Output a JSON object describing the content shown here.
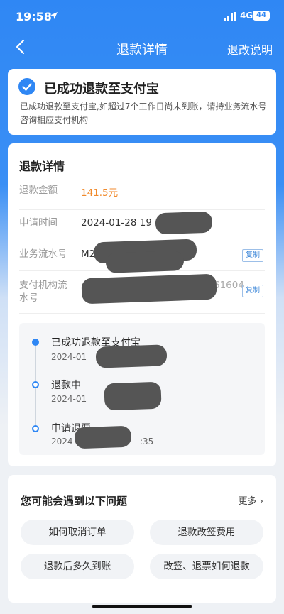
{
  "status_bar": {
    "time": "19:58",
    "network": "4G",
    "battery": "44"
  },
  "nav": {
    "title": "退款详情",
    "right_link": "退改说明"
  },
  "result": {
    "headline": "已成功退款至支付宝",
    "description": "已成功退款至支付宝,如超过7个工作日尚未到账，请持业务流水号咨询相应支付机构"
  },
  "details": {
    "title": "退款详情",
    "rows": [
      {
        "label": "退款金额",
        "value": "141.5元"
      },
      {
        "label": "申请时间",
        "value": "2024-01-28 19"
      },
      {
        "label": "业务流水号",
        "value": "M2",
        "copy": "复制"
      },
      {
        "label": "支付机构流水号",
        "value": "61604",
        "copy": "复制"
      }
    ]
  },
  "timeline": [
    {
      "title": "已成功退款至支付宝",
      "date": "2024-01"
    },
    {
      "title": "退款中",
      "date": "2024-01"
    },
    {
      "title": "申请退票",
      "date": "2024",
      "date_tail": ":35"
    }
  ],
  "faq": {
    "title": "您可能会遇到以下问题",
    "more": "更多",
    "items": [
      "如何取消订单",
      "退款改签费用",
      "退款后多久到账",
      "改签、退票如何退款"
    ]
  },
  "colors": {
    "primary": "#2f87f4",
    "amount": "#f08a2c"
  }
}
